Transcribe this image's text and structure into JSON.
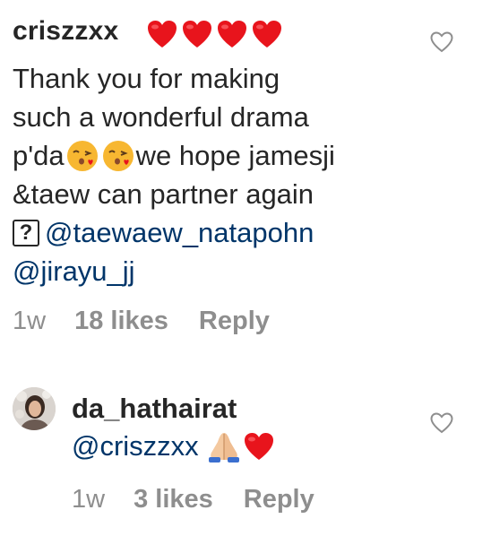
{
  "comments": [
    {
      "username": "criszzxx",
      "hearts": 4,
      "lines": [
        "Thank you for making",
        "such a wonderful  drama",
        "p'da",
        "we hope jamesji",
        "&taew can partner again",
        "?",
        "@taewaew_natapohn",
        "@jirayu_jj"
      ],
      "time": "1w",
      "likes": "18 likes",
      "reply": "Reply"
    },
    {
      "username": "da_hathairat",
      "mention": "@criszzxx",
      "time": "1w",
      "likes": "3 likes",
      "reply": "Reply"
    }
  ],
  "icons": {
    "like": "heart-outline-icon",
    "heart_emoji": "red-heart-emoji",
    "kiss_emoji": "face-blowing-kiss-emoji",
    "pray_emoji": "folded-hands-emoji",
    "unknown_glyph": "question-box-glyph"
  },
  "colors": {
    "text": "#262626",
    "meta": "#8e8e8e",
    "mention": "#003569",
    "heart": "#e8141c"
  }
}
